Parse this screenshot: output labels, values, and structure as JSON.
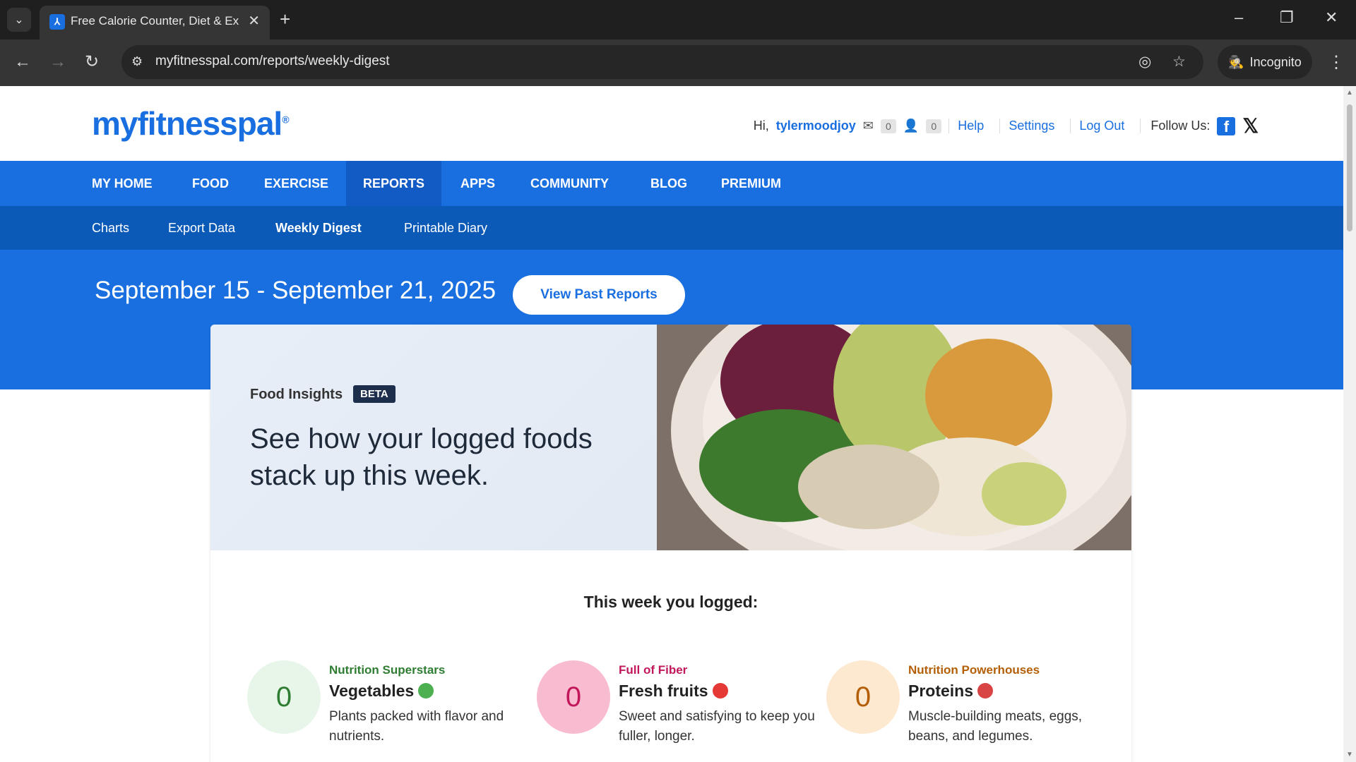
{
  "browser": {
    "tab_title": "Free Calorie Counter, Diet & Ex",
    "url": "myfitnesspal.com/reports/weekly-digest",
    "incognito_label": "Incognito"
  },
  "header": {
    "logo": "myfitnesspal",
    "greeting": "Hi,",
    "username": "tylermoodjoy",
    "messages_count": "0",
    "friends_count": "0",
    "help": "Help",
    "settings": "Settings",
    "logout": "Log Out",
    "follow_us": "Follow Us:"
  },
  "main_nav": [
    "MY HOME",
    "FOOD",
    "EXERCISE",
    "REPORTS",
    "APPS",
    "COMMUNITY",
    "BLOG",
    "PREMIUM"
  ],
  "sub_nav": [
    "Charts",
    "Export Data",
    "Weekly Digest",
    "Printable Diary"
  ],
  "hero": {
    "date_range": "September 15 - September 21, 2025",
    "view_past": "View Past Reports"
  },
  "insights": {
    "label": "Food Insights",
    "badge": "BETA",
    "headline": "See how your logged foods stack up this week.",
    "logged_title": "This week you logged:"
  },
  "stats": [
    {
      "count": "0",
      "eyebrow": "Nutrition Superstars",
      "title": "Vegetables",
      "desc": "Plants packed with flavor and nutrients.",
      "color": "#2e7d32",
      "bg": "#e8f5e9",
      "icon": "broccoli-icon",
      "icon_color": "#4caf50"
    },
    {
      "count": "0",
      "eyebrow": "Full of Fiber",
      "title": "Fresh fruits",
      "desc": "Sweet and satisfying to keep you fuller, longer.",
      "color": "#c2185b",
      "bg": "#f8bbd0",
      "icon": "strawberry-icon",
      "icon_color": "#e53935"
    },
    {
      "count": "0",
      "eyebrow": "Nutrition Powerhouses",
      "title": "Proteins",
      "desc": "Muscle-building meats, eggs, beans, and legumes.",
      "color": "#b45f06",
      "bg": "#fde8d0",
      "icon": "meat-icon",
      "icon_color": "#d84343"
    }
  ]
}
